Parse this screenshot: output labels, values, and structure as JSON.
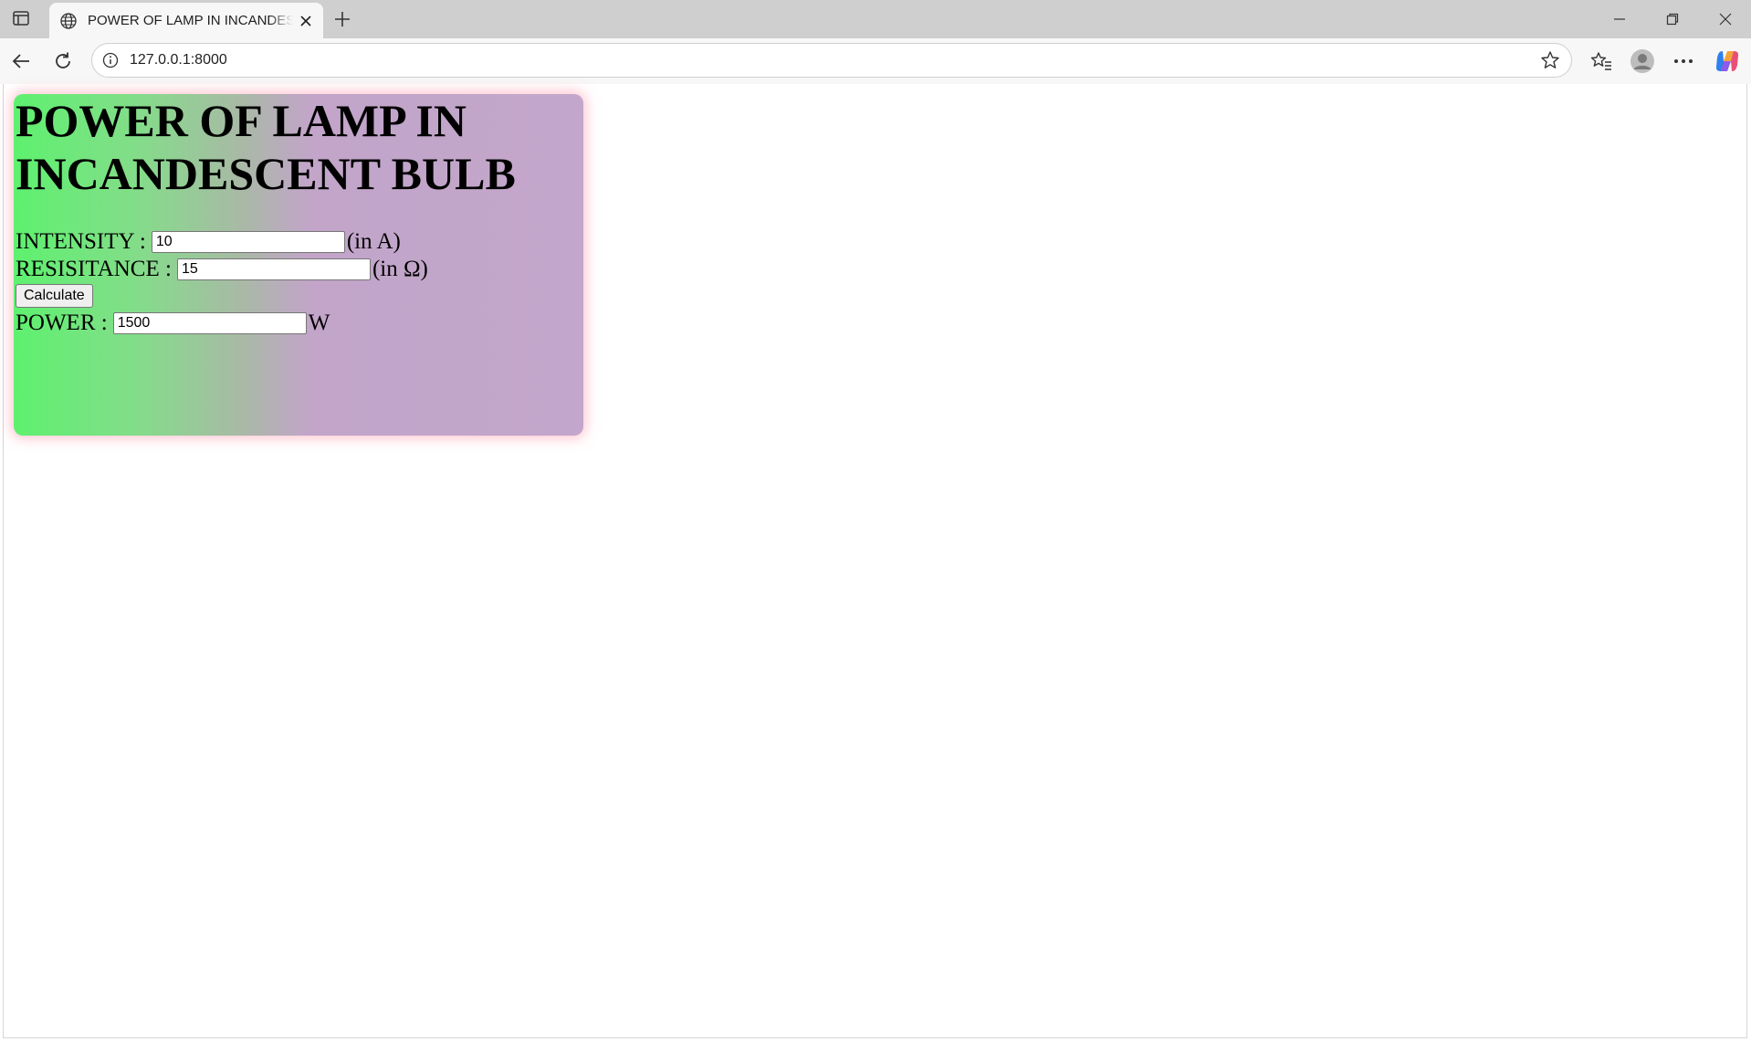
{
  "browser": {
    "tab_title": "POWER OF LAMP IN INCANDESCENT BULB",
    "url": "127.0.0.1:8000"
  },
  "page": {
    "heading": "POWER OF LAMP IN INCANDESCENT BULB",
    "intensity": {
      "label": "INTENSITY :",
      "value": "10",
      "unit": "(in A)"
    },
    "resistance": {
      "label": "RESISITANCE :",
      "value": "15",
      "unit": "(in Ω)"
    },
    "calculate_label": "Calculate",
    "power": {
      "label": "POWER :",
      "value": "1500",
      "unit": "W"
    }
  }
}
